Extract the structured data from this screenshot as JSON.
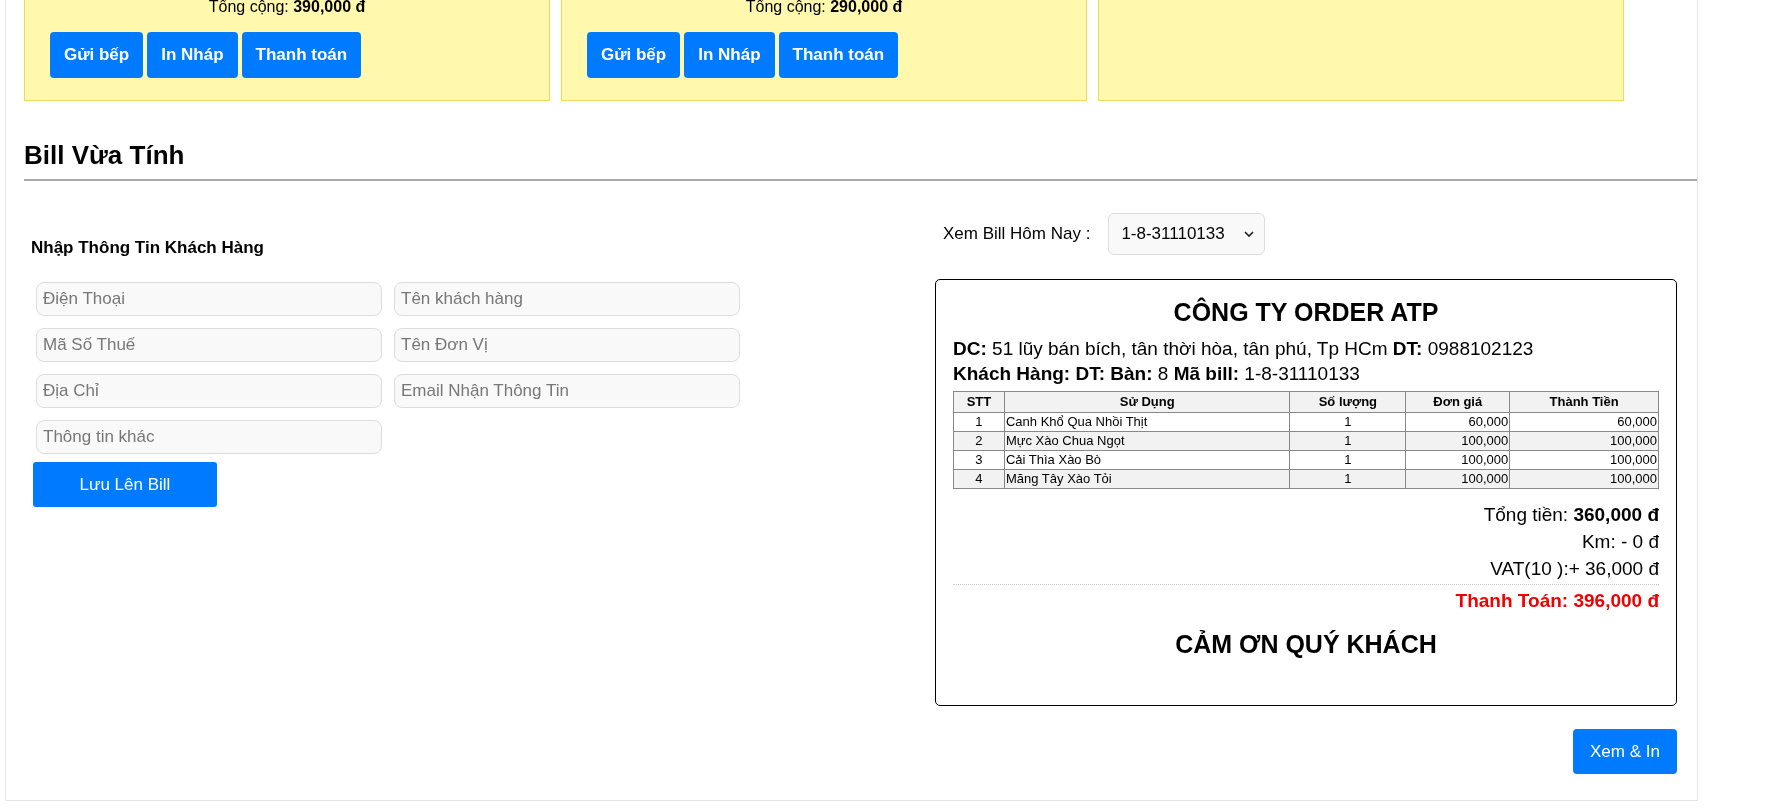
{
  "order_cards": [
    {
      "kind": "order",
      "total": "Tổng cộng: **390,000 đ**",
      "buttons": [
        "Gửi bếp",
        "In Nháp",
        "Thanh toán"
      ]
    },
    {
      "kind": "order",
      "total": "Tổng cộng: **290,000 đ**",
      "buttons": [
        "Gửi bếp",
        "In Nháp",
        "Thanh toán"
      ]
    },
    {
      "kind": "blank"
    }
  ],
  "section_title": "Bill Vừa Tính",
  "customer_form": {
    "title": "Nhập Thông Tin Khách Hàng",
    "fields": [
      {
        "placeholder": "Điện Thoại"
      },
      {
        "placeholder": "Tên khách hàng"
      },
      {
        "placeholder": "Mã Số Thuế"
      },
      {
        "placeholder": "Tên Đơn Vị"
      },
      {
        "placeholder": "Địa Chỉ"
      },
      {
        "placeholder": "Email Nhận Thông Tin"
      },
      {
        "placeholder": "Thông tin khác"
      }
    ],
    "button": "Lưu Lên Bill"
  },
  "bill_viewer": {
    "label": "Xem Bill Hôm Nay :",
    "selected_bill": "1-8-31110133",
    "receipt": {
      "company": "CÔNG TY ORDER ATP",
      "info_lines": [
        "**DC:** 51 lũy bán bích, tân thời hòa, tân phú, Tp HCm **DT:** 0988102123",
        "**Khách Hàng: DT: Bàn:** 8 **Mã bill:** 1-8-31110133"
      ],
      "table": {
        "columns": [
          "STT",
          "Sử Dụng",
          "Số lượng",
          "Đơn giá",
          "Thành Tiền"
        ],
        "rows": [
          [
            "1",
            "Canh Khổ Qua Nhồi Thịt",
            "1",
            "60,000",
            "60,000"
          ],
          [
            "2",
            "Mực Xào Chua Ngọt",
            "1",
            "100,000",
            "100,000"
          ],
          [
            "3",
            "Cải Thìa Xào Bò",
            "1",
            "100,000",
            "100,000"
          ],
          [
            "4",
            "Măng Tây Xào Tỏi",
            "1",
            "100,000",
            "100,000"
          ]
        ]
      },
      "totals": [
        {
          "kind": "line",
          "text": "Tổng tiền: **360,000 đ**"
        },
        {
          "kind": "line",
          "text": "Km: - 0 đ"
        },
        {
          "kind": "line",
          "text": "VAT(10 ):+ 36,000 đ"
        },
        {
          "kind": "grand",
          "text": "Thanh Toán: 396,000 đ"
        }
      ],
      "footer": "CẢM ƠN QUÝ KHÁCH"
    },
    "print_button": "Xem & In"
  }
}
